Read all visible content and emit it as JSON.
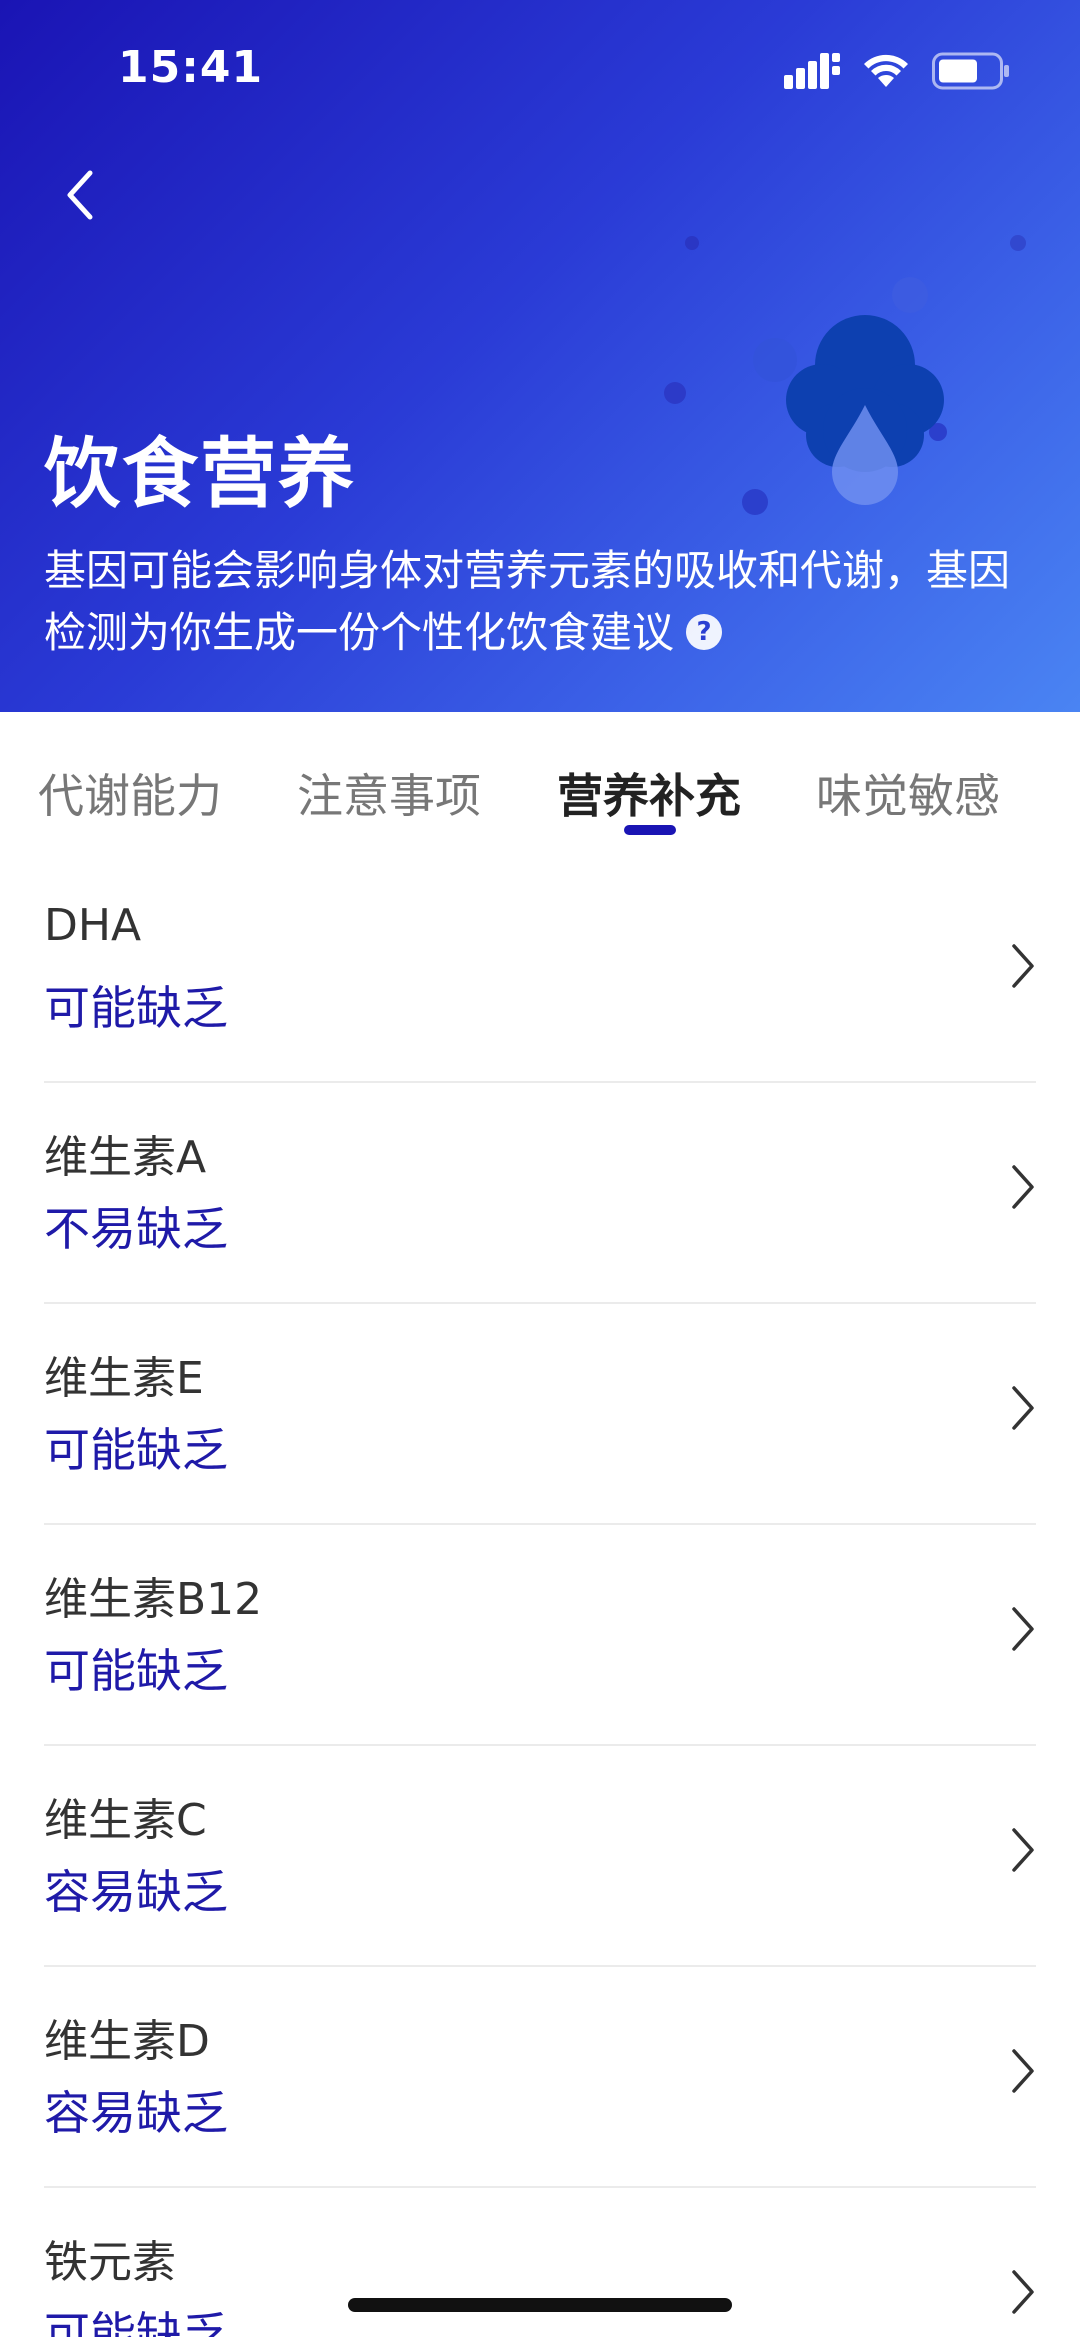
{
  "status_bar": {
    "time": "15:41",
    "icons": [
      "signal-icon",
      "wifi-icon",
      "battery-icon"
    ]
  },
  "header": {
    "back_icon": "chevron-left-icon",
    "title": "饮食营养",
    "description": "基因可能会影响身体对营养元素的吸收和代谢，基因检测为你生成一份个性化饮食建议",
    "help_icon": "question-circle-icon",
    "help_glyph": "?"
  },
  "tabs": [
    {
      "label": "代谢能力",
      "active": false
    },
    {
      "label": "注意事项",
      "active": false
    },
    {
      "label": "营养补充",
      "active": true
    },
    {
      "label": "味觉敏感",
      "active": false
    }
  ],
  "nutrients": [
    {
      "name": "DHA",
      "status": "可能缺乏"
    },
    {
      "name": "维生素A",
      "status": "不易缺乏"
    },
    {
      "name": "维生素E",
      "status": "可能缺乏"
    },
    {
      "name": "维生素B12",
      "status": "可能缺乏"
    },
    {
      "name": "维生素C",
      "status": "容易缺乏"
    },
    {
      "name": "维生素D",
      "status": "容易缺乏"
    },
    {
      "name": "铁元素",
      "status": "可能缺乏"
    }
  ],
  "colors": {
    "accent": "#1a14b4",
    "status_text": "#1f1aa8",
    "gradient_start": "#1a14b4",
    "gradient_end": "#4a84f3"
  }
}
